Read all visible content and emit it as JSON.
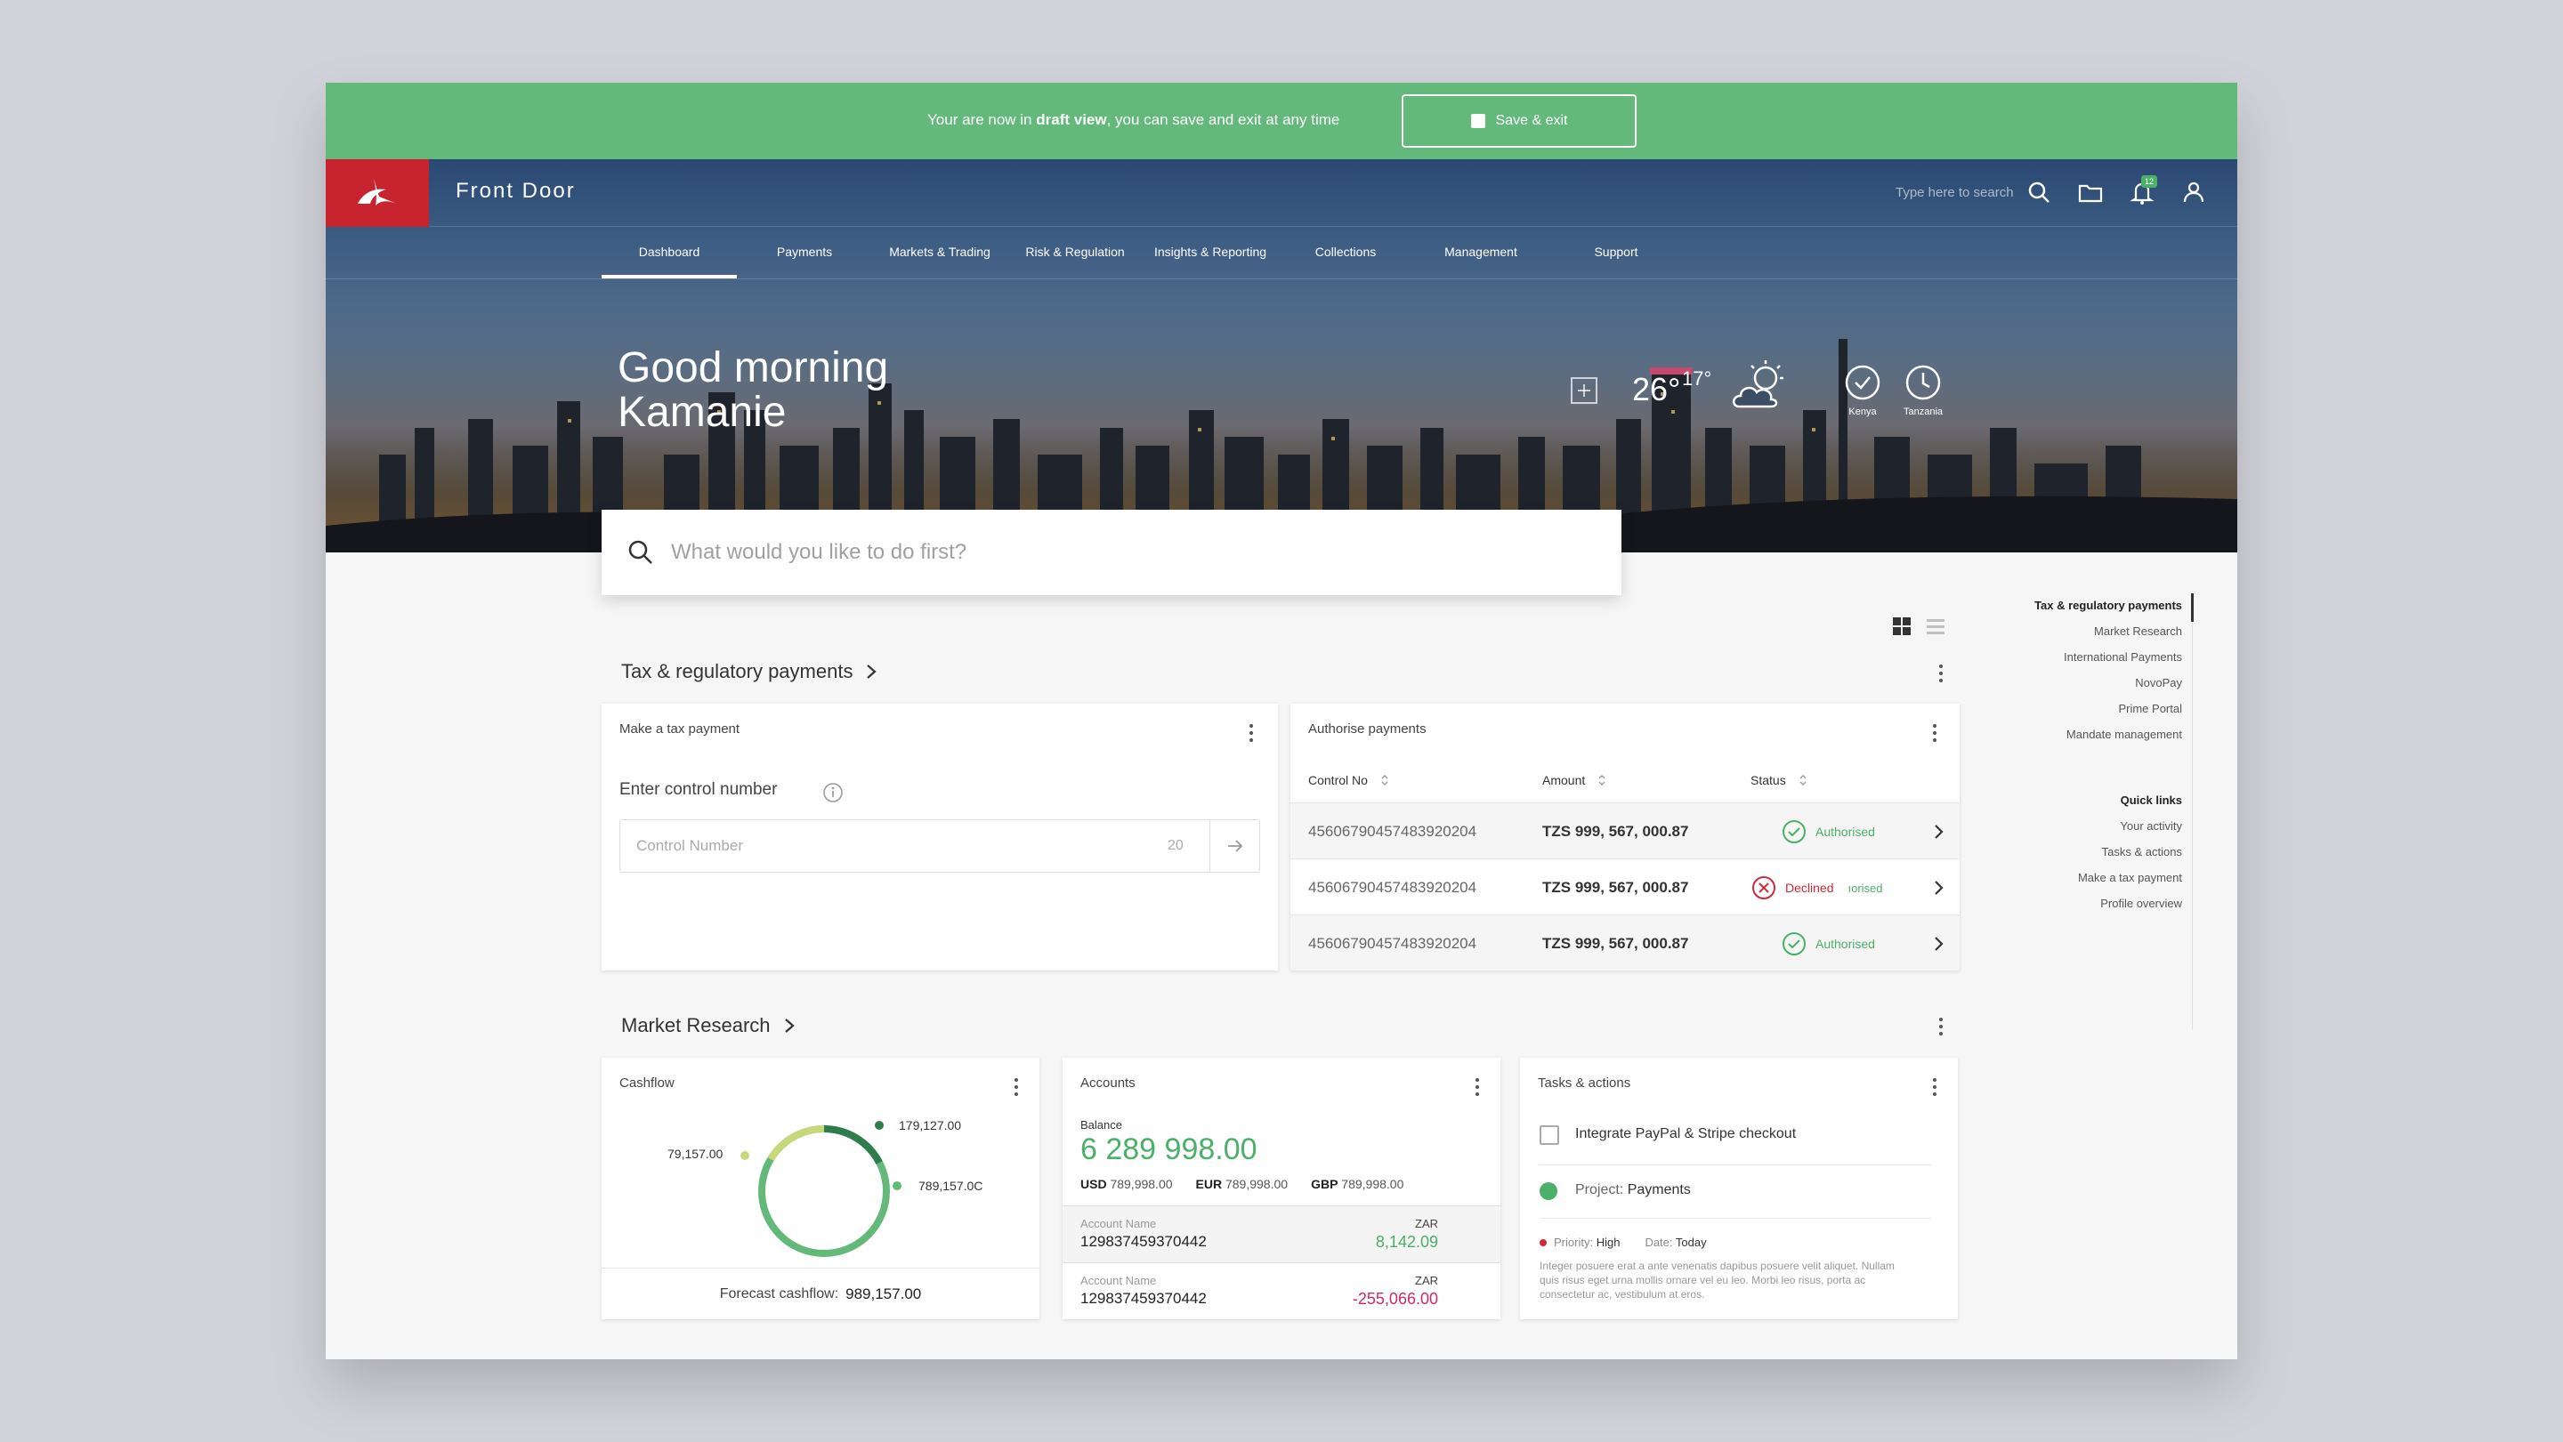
{
  "draft": {
    "text_before": "Your are now in ",
    "text_bold": "draft view",
    "text_after": ", you can save and exit at any time",
    "save_label": "Save & exit"
  },
  "header": {
    "brand": "Front Door",
    "search_placeholder": "Type here to search",
    "notification_count": "12"
  },
  "nav": {
    "items": [
      {
        "label": "Dashboard"
      },
      {
        "label": "Payments"
      },
      {
        "label": "Markets & Trading"
      },
      {
        "label": "Risk & Regulation"
      },
      {
        "label": "Insights & Reporting"
      },
      {
        "label": "Collections"
      },
      {
        "label": "Management"
      },
      {
        "label": "Support"
      }
    ]
  },
  "hero": {
    "greeting_line1": "Good morning",
    "greeting_line2": "Kamanie",
    "temp_high": "26°",
    "temp_low": "17°",
    "clocks": [
      {
        "label": "Kenya"
      },
      {
        "label": "Tanzania"
      }
    ],
    "search_placeholder": "What would you like to do first?"
  },
  "tax_section": {
    "title": "Tax & regulatory payments",
    "make_payment": {
      "title": "Make a tax payment",
      "field_label": "Enter control number",
      "placeholder": "Control Number",
      "max_chars": "20"
    },
    "authorise": {
      "title": "Authorise payments",
      "columns": [
        "Control No",
        "Amount",
        "Status"
      ],
      "rows": [
        {
          "control": "45606790457483920204",
          "amount": "TZS 999, 567, 000.87",
          "status": "Authorised",
          "ghost": ""
        },
        {
          "control": "45606790457483920204",
          "amount": "TZS 999, 567, 000.87",
          "status": "Declined",
          "ghost": "ıorised"
        },
        {
          "control": "45606790457483920204",
          "amount": "TZS 999, 567, 000.87",
          "status": "Authorised",
          "ghost": ""
        }
      ]
    }
  },
  "market_section": {
    "title": "Market Research",
    "cashflow": {
      "title": "Cashflow",
      "labels": [
        "179,127.00",
        "789,157.0C",
        "79,157.00"
      ],
      "forecast_label": "Forecast cashflow:",
      "forecast_value": "989,157.00"
    },
    "accounts": {
      "title": "Accounts",
      "balance_label": "Balance",
      "balance": "6 289 998.00",
      "currencies": [
        {
          "code": "USD",
          "value": "789,998.00"
        },
        {
          "code": "EUR",
          "value": "789,998.00"
        },
        {
          "code": "GBP",
          "value": "789,998.00"
        }
      ],
      "rows": [
        {
          "name_label": "Account Name",
          "number": "129837459370442",
          "currency": "ZAR",
          "amount": "8,142.09"
        },
        {
          "name_label": "Account Name",
          "number": "129837459370442",
          "currency": "ZAR",
          "amount": "-255,066.00"
        }
      ]
    },
    "tasks": {
      "title": "Tasks & actions",
      "task": "Integrate PayPal & Stripe checkout",
      "project_label": "Project:",
      "project_value": "Payments",
      "priority_label": "Priority:",
      "priority_value": "High",
      "date_label": "Date:",
      "date_value": "Today",
      "description": "Integer posuere erat a ante venenatis dapibus posuere velit aliquet. Nullam quis risus eget urna mollis ornare vel eu leo. Morbi leo risus, porta ac consectetur ac, vestibulum at eros."
    }
  },
  "rail": {
    "section_items": [
      "Tax & regulatory payments",
      "Market Research",
      "International Payments",
      "NovoPay",
      "Prime Portal",
      "Mandate management"
    ],
    "quick_links_title": "Quick links",
    "quick_links": [
      "Your activity",
      "Tasks & actions",
      "Make a tax payment",
      "Profile overview"
    ]
  },
  "colors": {
    "accent_green": "#4caf6a",
    "banner_green": "#63b97a",
    "brand_red": "#c8242f",
    "negative": "#d0286a"
  }
}
